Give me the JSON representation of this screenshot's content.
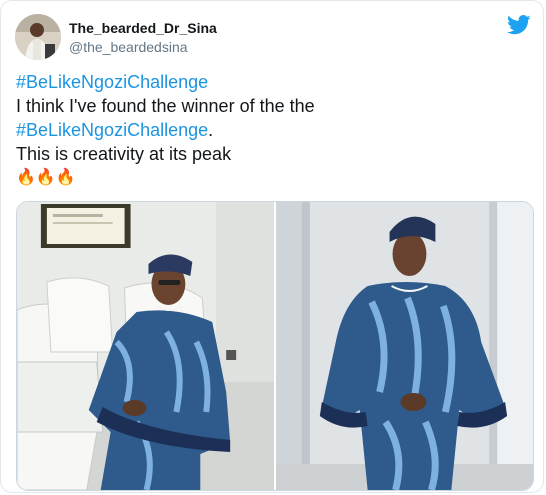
{
  "author": {
    "display_name": "The_bearded_Dr_Sina",
    "handle": "@the_beardedsina",
    "avatar_icon": "user-avatar-photo"
  },
  "brand": {
    "icon": "twitter-bird-icon",
    "color": "#1da1f2"
  },
  "tweet": {
    "line1_hashtag": "#BeLikeNgoziChallenge",
    "line2_text": "I think I've found the winner of the the",
    "line3_hashtag": "#BeLikeNgoziChallenge",
    "line3_suffix": ".",
    "line4_text": "This is creativity at its peak",
    "emojis": "🔥🔥🔥",
    "hashtag_color": "#1b95e0"
  },
  "media": {
    "photos": [
      {
        "description_icon": "seated-woman-photo"
      },
      {
        "description_icon": "standing-woman-photo"
      }
    ]
  }
}
